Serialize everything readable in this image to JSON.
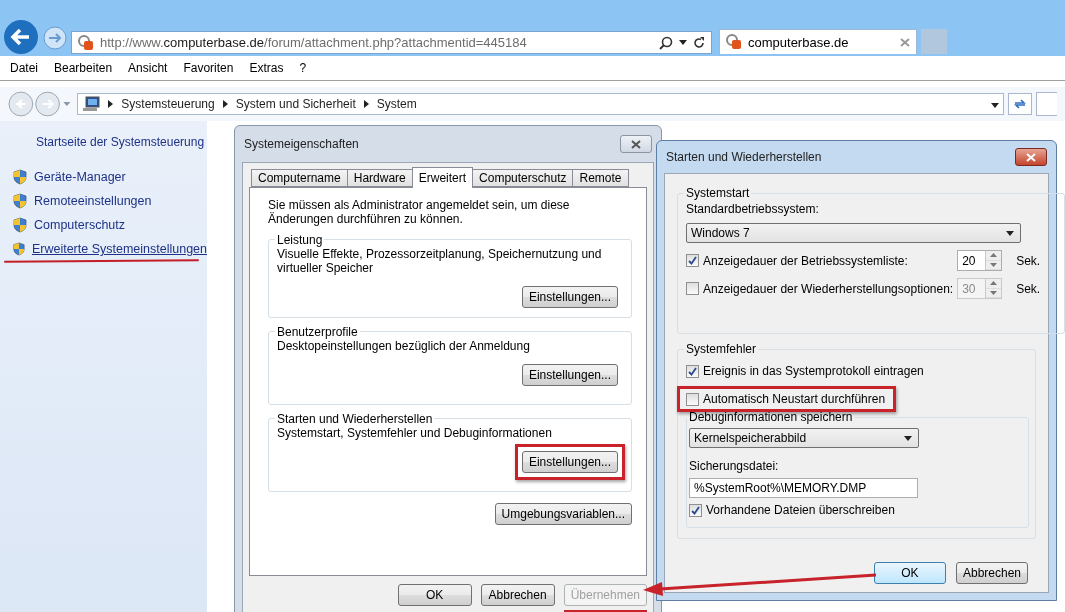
{
  "browser": {
    "url": "http://www.**computerbase.de**/forum/attachment.php?attachmentid=445184",
    "tab": {
      "title": "computerbase.de",
      "selected": true
    },
    "menu": [
      "Datei",
      "Bearbeiten",
      "Ansicht",
      "Favoriten",
      "Extras",
      "?"
    ]
  },
  "explorer": {
    "breadcrumb": [
      "Systemsteuerung",
      "System und Sicherheit",
      "System"
    ]
  },
  "sidebar": {
    "home": "Startseite der Systemsteuerung",
    "items": [
      {
        "label": "Geräte-Manager",
        "annotated": false
      },
      {
        "label": "Remoteeinstellungen",
        "annotated": false
      },
      {
        "label": "Computerschutz",
        "annotated": false
      },
      {
        "label": "Erweiterte Systemeinstellungen",
        "annotated": true
      }
    ]
  },
  "system_properties": {
    "title": "Systemeigenschaften",
    "tabs": [
      {
        "label": "Computername",
        "selected": false
      },
      {
        "label": "Hardware",
        "selected": false
      },
      {
        "label": "Erweitert",
        "selected": true
      },
      {
        "label": "Computerschutz",
        "selected": false
      },
      {
        "label": "Remote",
        "selected": false
      }
    ],
    "notice": "Sie müssen als Administrator angemeldet sein, um diese Änderungen durchführen zu können.",
    "groups": [
      {
        "title": "Leistung",
        "text": "Visuelle Effekte, Prozessorzeitplanung, Speichernutzung und virtueller Speicher",
        "button": "Einstellungen...",
        "annotated": false
      },
      {
        "title": "Benutzerprofile",
        "text": "Desktopeinstellungen bezüglich der Anmeldung",
        "button": "Einstellungen...",
        "annotated": false
      },
      {
        "title": "Starten und Wiederherstellen",
        "text": "Systemstart, Systemfehler und Debuginformationen",
        "button": "Einstellungen...",
        "annotated": true
      }
    ],
    "env_button": "Umgebungsvariablen...",
    "buttons": [
      {
        "label": "OK",
        "disabled": false,
        "annotated": false
      },
      {
        "label": "Abbrechen",
        "disabled": false,
        "annotated": false
      },
      {
        "label": "Übernehmen",
        "disabled": true,
        "annotated": true
      }
    ]
  },
  "startup_recovery": {
    "title": "Starten und Wiederherstellen",
    "systemstart": {
      "title": "Systemstart",
      "os_label": "Standardbetriebssystem:",
      "os_value": "Windows 7",
      "rows": [
        {
          "label": "Anzeigedauer der Betriebssystemliste:",
          "checked": true,
          "value": "20",
          "disabled": false,
          "unit": "Sek."
        },
        {
          "label": "Anzeigedauer der Wiederherstellungsoptionen:",
          "checked": false,
          "value": "30",
          "disabled": true,
          "unit": "Sek."
        }
      ]
    },
    "systemfehler": {
      "title": "Systemfehler",
      "checks": [
        {
          "label": "Ereignis in das Systemprotokoll eintragen",
          "checked": true,
          "annotated": false
        },
        {
          "label": "Automatisch Neustart durchführen",
          "checked": false,
          "annotated": true
        }
      ],
      "debug": {
        "title": "Debuginformationen speichern",
        "type": "Kernelspeicherabbild",
        "file_label": "Sicherungsdatei:",
        "file_value": "%SystemRoot%\\MEMORY.DMP",
        "overwrite": {
          "label": "Vorhandene Dateien überschreiben",
          "checked": true
        }
      }
    },
    "buttons": [
      {
        "label": "OK",
        "default": true
      },
      {
        "label": "Abbrechen",
        "default": false
      }
    ]
  }
}
